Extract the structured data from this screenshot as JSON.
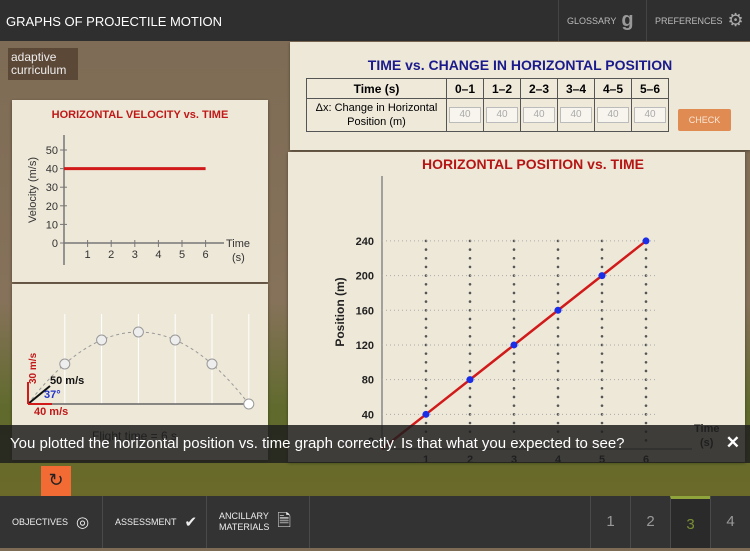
{
  "header": {
    "title": "GRAPHS OF PROJECTILE MOTION",
    "glossary": "GLOSSARY",
    "glossary_icon": "g",
    "preferences": "PREFERENCES"
  },
  "logo": {
    "line1": "adaptive",
    "line2": "curriculum"
  },
  "velocity_chart": {
    "title": "HORIZONTAL VELOCITY vs. TIME",
    "ylabel": "Velocity (m/s)",
    "xlabel": "Time",
    "xunit": "(s)",
    "yticks": [
      0,
      10,
      20,
      30,
      40,
      50
    ],
    "xticks": [
      1,
      2,
      3,
      4,
      5,
      6
    ]
  },
  "trajectory": {
    "vy": "30 m/s",
    "v": "50 m/s",
    "angle": "37°",
    "vx": "40 m/s",
    "flight_time": "Flight time = 6 s"
  },
  "table": {
    "title": "TIME vs. CHANGE IN HORIZONTAL POSITION",
    "header": "Time (s)",
    "intervals": [
      "0–1",
      "1–2",
      "2–3",
      "3–4",
      "4–5",
      "5–6"
    ],
    "row_label": "Δx: Change in Horizontal Position (m)",
    "values": [
      "40",
      "40",
      "40",
      "40",
      "40",
      "40"
    ],
    "check": "CHECK"
  },
  "chart_data": [
    {
      "type": "line",
      "title": "HORIZONTAL VELOCITY vs. TIME",
      "xlabel": "Time (s)",
      "ylabel": "Velocity (m/s)",
      "x": [
        0,
        6
      ],
      "y": [
        40,
        40
      ],
      "xlim": [
        0,
        6
      ],
      "ylim": [
        0,
        50
      ],
      "color": "#d11a1a"
    },
    {
      "type": "line",
      "title": "HORIZONTAL POSITION vs. TIME",
      "xlabel": "Time (s)",
      "ylabel": "Position (m)",
      "x": [
        0,
        1,
        2,
        3,
        4,
        5,
        6
      ],
      "y": [
        0,
        40,
        80,
        120,
        160,
        200,
        240
      ],
      "xlim": [
        0,
        6
      ],
      "ylim": [
        0,
        240
      ],
      "yticks": [
        0,
        40,
        80,
        120,
        160,
        200,
        240
      ],
      "xticks": [
        1,
        2,
        3,
        4,
        5,
        6
      ],
      "grid": true,
      "color": "#d11a1a",
      "point_color": "#1a2ee8"
    }
  ],
  "position_chart": {
    "title": "HORIZONTAL POSITION vs. TIME",
    "ylabel": "Position (m)",
    "xlabel": "Time",
    "xunit": "(s)"
  },
  "message": {
    "text": "You plotted the horizontal position vs. time graph correctly. Is that what you expected to see?"
  },
  "bottom": {
    "objectives": "OBJECTIVES",
    "assessment": "ASSESSMENT",
    "ancillary1": "ANCILLARY",
    "ancillary2": "MATERIALS",
    "pages": [
      "1",
      "2",
      "3",
      "4"
    ],
    "active_page": "3"
  }
}
